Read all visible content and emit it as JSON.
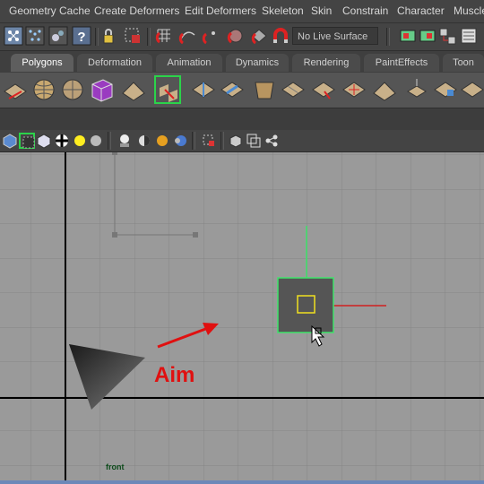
{
  "menu": {
    "items": [
      {
        "label": "Geometry Cache"
      },
      {
        "label": "Create Deformers"
      },
      {
        "label": "Edit Deformers"
      },
      {
        "label": "Skeleton"
      },
      {
        "label": "Skin"
      },
      {
        "label": "Constrain"
      },
      {
        "label": "Character"
      },
      {
        "label": "Muscle"
      }
    ]
  },
  "status_line": {
    "live_surface": "No Live Surface",
    "icons": [
      "select-by-hierarchy-icon",
      "select-by-component-icon",
      "select-by-object-icon",
      "help-icon",
      "lock-icon",
      "selection-mask-icon",
      "snap-to-grid-icon",
      "snap-to-curve-icon",
      "snap-to-point-icon",
      "snap-to-view-plane-icon",
      "make-live-icon",
      "history-icon",
      "render-icon",
      "ipr-icon",
      "render-settings-icon"
    ]
  },
  "shelf": {
    "tabs": [
      {
        "label": "Polygons",
        "active": true
      },
      {
        "label": "Deformation"
      },
      {
        "label": "Animation"
      },
      {
        "label": "Dynamics"
      },
      {
        "label": "Rendering"
      },
      {
        "label": "PaintEffects"
      },
      {
        "label": "Toon"
      }
    ],
    "icons": [
      "poly-sphere-icon",
      "poly-cube-icon",
      "poly-cylinder-icon",
      "poly-plane-icon",
      "poly-torus-icon",
      "combine-icon",
      "separate-icon",
      "extract-icon",
      "smooth-icon",
      "bool-union-icon",
      "bool-difference-icon",
      "bool-intersection-icon",
      "mirror-icon",
      "extrude-icon",
      "bridge-icon",
      "append-icon",
      "split-icon",
      "insert-edgeloop-icon",
      "offset-edgeloop-icon"
    ]
  },
  "panel_toolbar": {
    "icons": [
      "wireframe-icon",
      "smooth-shade-icon",
      "textured-icon",
      "use-all-lights-icon",
      "shadows-icon",
      "isolate-select-icon",
      "xray-icon",
      "xray-joints-icon",
      "grid-icon",
      "resolution-gate-icon",
      "camera-icon"
    ]
  },
  "viewport": {
    "camera_label": "front",
    "annotation": "Aim"
  },
  "colors": {
    "annotation_arrow": "#e01010",
    "selection_highlight": "#3ee36a",
    "y_axis": "#3ee36a",
    "x_axis": "#d02020",
    "viewport_bg": "#9a9a9a",
    "grid_line": "#868686",
    "origin_line": "#000000"
  }
}
